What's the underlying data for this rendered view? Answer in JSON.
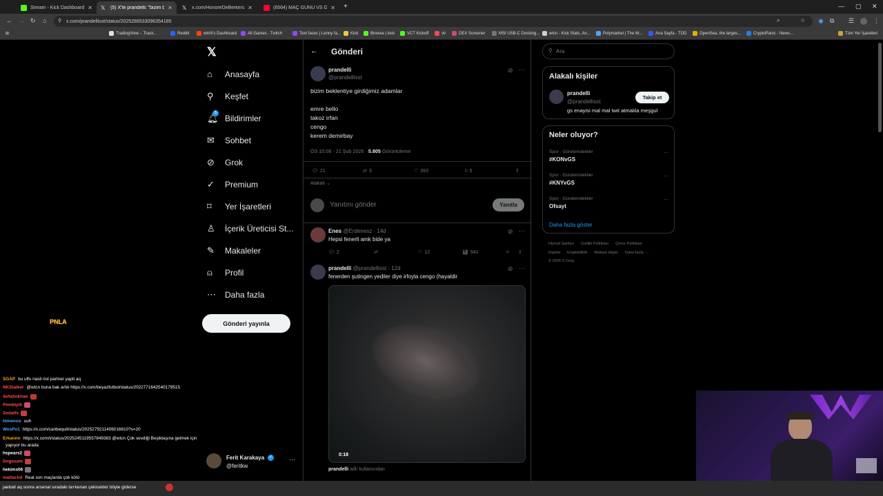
{
  "browser": {
    "tabs": [
      {
        "title": "Stream - Kick Dashboard",
        "fav": "#53fc18"
      },
      {
        "title": "(5) X'te prandelli: \"bizim bekler",
        "fav": "#ffffff"
      },
      {
        "title": "x.com/HonoreDeBerke/status/...",
        "fav": "#ffffff"
      },
      {
        "title": "(6564) MAÇ GÜNÜ VS GENTLE",
        "fav": "#ff0033"
      }
    ],
    "url": "x.com/prandellisst/status/2025286533096354185",
    "bookmarks": [
      "TradingView – Track...",
      "Reddit",
      "wtcN's Dashboard",
      "All Games - Twitch",
      "Text faces | Lenny fa...",
      "Kick",
      "Browse | kick",
      "VCT Kickoff",
      "vlr",
      "DEX Screener",
      "MSI USB-C Docking...",
      "wtcn - Kick Stats, An...",
      "Polymarket | The W...",
      "Ana Sayfa - TOD",
      "OpenSea, the larges...",
      "CryptoPanic - News..."
    ],
    "bookmarks_all": "Tüm Yer İşaretleri"
  },
  "nav": {
    "items": [
      "Anasayfa",
      "Keşfet",
      "Bildirimler",
      "Sohbet",
      "Grok",
      "Premium",
      "Yer İşaretleri",
      "İçerik Üreticisi St...",
      "Makaleler",
      "Profil",
      "Daha fazla"
    ],
    "notif_badge": "5",
    "post_button": "Gönderi yayınla",
    "account_name": "Ferit Karakaya",
    "account_handle": "@feritkw"
  },
  "post": {
    "header": "Gönderi",
    "author": "prandelli",
    "handle": "@prandellisst",
    "text_lines": [
      "bizim beklentiye girdiğimiz adamlar",
      "",
      "emre bello",
      "takoz irfan",
      "cengo",
      "kerem demirbay"
    ],
    "time": "ÖS 10:08 · 21 Şub 2026 · ",
    "views": "5.805",
    "views_label": "Görüntüleme",
    "replies": "21",
    "reposts": "3",
    "likes": "393",
    "bookmarks": "5",
    "relevant": "Alakalı",
    "reply_placeholder": "Yanıtını gönder",
    "reply_button": "Yanıtla"
  },
  "replies": [
    {
      "author": "Enes",
      "handle": "@Erdenesz · 14d",
      "text": "Hepsi fenerli amk bide ya",
      "replies": "2",
      "likes": "12",
      "views": "541"
    },
    {
      "author": "prandelli",
      "handle": "@prandellisst · 12d",
      "text": "fenerden şutingen yediler diye irfoyla cengo (hayaldir",
      "video_time": "0:18",
      "footer_author": "prandelli",
      "footer_text": "adlı kullanıcıdan"
    }
  ],
  "right": {
    "search_placeholder": "Ara",
    "related_title": "Alakalı kişiler",
    "person_name": "prandelli",
    "person_handle": "@prandellisst",
    "person_bio": "gs enayisi mal mal twit atmakla meşgul",
    "follow": "Takip et",
    "trends_title": "Neler oluyor?",
    "trends": [
      {
        "cat": "Spor · Gündemdekiler",
        "name": "#KONvGS"
      },
      {
        "cat": "Spor · Gündemdekiler",
        "name": "#KNYvGS"
      },
      {
        "cat": "Spor · Gündemdekiler",
        "name": "Ofsayt"
      }
    ],
    "show_more": "Daha fazla göster",
    "footer1": [
      "Hizmet Şartları",
      "Gizlilik Politikası",
      "Çerez Politikası"
    ],
    "footer2": [
      "Imprint",
      "Erişilebilirlik",
      "Reklam bilgisi",
      "Daha fazla ···"
    ],
    "copyright": "© 2026 X Corp."
  },
  "chat": [
    {
      "user": "SGAP",
      "color": "#f5a623",
      "msg": "bu ulfu nasil riot partner yapti aq"
    },
    {
      "user": "NKStalker",
      "color": "#ff4d4d",
      "msg": "@wtcn buna bak artık https://x.com/beyazfutbol/status/2022771642540179515"
    },
    {
      "user": "SefaSokhan",
      "color": "#ff4d4d",
      "msg": ""
    },
    {
      "user": "Pembiyiii",
      "color": "#ff4d4d",
      "msg": ""
    },
    {
      "user": "Sedatfx",
      "color": "#ff4d4d",
      "msg": ""
    },
    {
      "user": "himenoo",
      "color": "#4da6ff",
      "msg": "uuh"
    },
    {
      "user": "WesPo1",
      "color": "#4da6ff",
      "msg": "https://x.com/canbequit/status/2025279211406016610?s=20"
    },
    {
      "user": "Erkannn",
      "color": "#f5a623",
      "msg": "https://x.com/i/status/2025245119557849383 @wtcn Çok sevdiği Beşiktaşına gelmek için"
    },
    {
      "user": "",
      "color": "#ffffff",
      "msg": "yapıyor bu arada"
    },
    {
      "user": "hspears2",
      "color": "#ffffff",
      "msg": ""
    },
    {
      "user": "Dogasam",
      "color": "#ff4d4d",
      "msg": ""
    },
    {
      "user": "hekims06",
      "color": "#ffffff",
      "msg": ""
    },
    {
      "user": "mattachd",
      "color": "#ff4d4d",
      "msg": "Real son maçlarda çok kötü"
    }
  ],
  "chat_bottom": "jaeball  aq sonra arsenal sıradaki ta+kenan çekicekler böyle giderse",
  "overlay_logo": "PNLA"
}
